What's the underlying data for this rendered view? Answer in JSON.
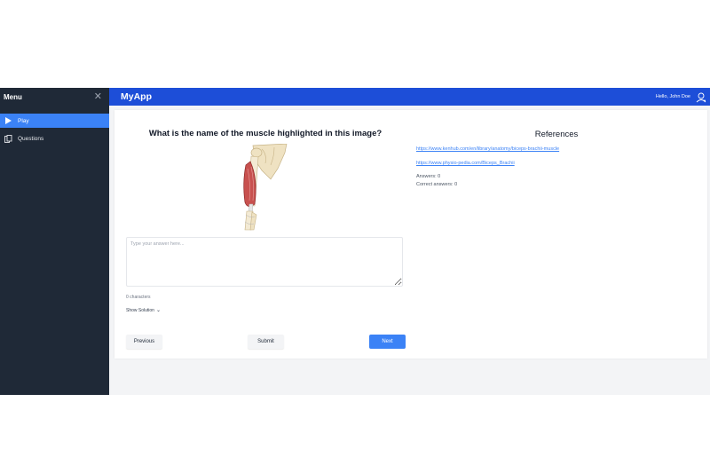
{
  "sidebar": {
    "title": "Menu",
    "close_icon": "close-icon",
    "items": [
      {
        "label": "Play",
        "icon": "play-icon",
        "active": true
      },
      {
        "label": "Questions",
        "icon": "copy-icon",
        "active": false
      }
    ]
  },
  "topbar": {
    "brand": "MyApp",
    "greeting": "Hello, John Doe",
    "avatar_icon": "avatar-icon"
  },
  "quiz": {
    "question": "What is the name of the muscle highlighted in this image?",
    "image_icon": "arm-muscle-illustration",
    "answer_placeholder": "Type your answer here...",
    "answer_value": "",
    "char_count": "0 characters",
    "show_solution_label": "Show Solution",
    "previous_label": "Previous",
    "submit_label": "Submit",
    "next_label": "Next"
  },
  "references": {
    "title": "References",
    "links": [
      "https://www.kenhub.com/en/library/anatomy/biceps-brachii-muscle",
      "https://www.physio-pedia.com/Biceps_Brachii"
    ],
    "answers_text": "Answers: 0",
    "correct_text": "Correct answers: 0"
  },
  "colors": {
    "sidebar_bg": "#1f2937",
    "topbar_bg": "#1d4ed8",
    "accent": "#3b82f6",
    "content_bg": "#f3f4f6"
  }
}
